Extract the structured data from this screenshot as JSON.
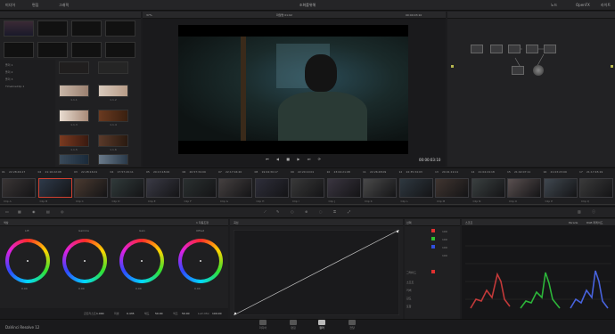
{
  "app": {
    "title": "조화를위해",
    "version": "DaVinci Resolve 12"
  },
  "topbar": {
    "left_items": [
      "미디어",
      "편집",
      "그래픽"
    ],
    "right_items": [
      "노드",
      "OpenFX",
      "라이트"
    ]
  },
  "viewer": {
    "title": "클립뷰어",
    "clip_name": "파일명 01:02",
    "timecode": "00:00:03:10",
    "zoom": "37%"
  },
  "media_pool": {
    "folders": [
      "폴더 1",
      "폴더 2",
      "폴더 3",
      "TimelineClip 1"
    ],
    "thumb_labels": [
      "1.1.1",
      "1.1.2",
      "1.1.3",
      "1.1.4",
      "1.1.5",
      "1.1.6",
      "1.1.7"
    ]
  },
  "timeline_clips": [
    {
      "num": "01",
      "tc": "22:28:46:17",
      "name": "Clip A"
    },
    {
      "num": "02",
      "tc": "21:16:22:08",
      "name": "Clip B"
    },
    {
      "num": "03",
      "tc": "22:28:16:01",
      "name": "Clip C"
    },
    {
      "num": "04",
      "tc": "17:57:20:11",
      "name": "Clip D"
    },
    {
      "num": "05",
      "tc": "20:13:18:00",
      "name": "Clip E"
    },
    {
      "num": "06",
      "tc": "20:57:34:09",
      "name": "Clip F"
    },
    {
      "num": "07",
      "tc": "22:17:04:20",
      "name": "Clip G"
    },
    {
      "num": "08",
      "tc": "19:04:30:17",
      "name": "Clip H"
    },
    {
      "num": "09",
      "tc": "22:20:10:01",
      "name": "Clip I"
    },
    {
      "num": "10",
      "tc": "23:04:21:08",
      "name": "Clip J"
    },
    {
      "num": "11",
      "tc": "22:26:48:09",
      "name": "Clip K"
    },
    {
      "num": "12",
      "tc": "22:35:34:03",
      "name": "Clip L"
    },
    {
      "num": "13",
      "tc": "20:01:19:11",
      "name": "Clip M"
    },
    {
      "num": "14",
      "tc": "21:04:24:18",
      "name": "Clip N"
    },
    {
      "num": "15",
      "tc": "21:02:07:11",
      "name": "Clip O"
    },
    {
      "num": "16",
      "tc": "21:03:23:09",
      "name": "Clip P"
    },
    {
      "num": "17",
      "tc": "21:17:45:19",
      "name": "Clip Q"
    }
  ],
  "color_panel": {
    "title": "색상",
    "mode": "1 자동조정",
    "wheels": [
      "Lift",
      "Gamma",
      "Gain",
      "Offset"
    ],
    "wheel_values": [
      "0.00",
      "0.00",
      "0.00",
      "0.00"
    ],
    "bottom_labels": [
      "콘트라스트",
      "피벗",
      "채도",
      "색조",
      "Lum Mix"
    ],
    "bottom_values": [
      "1.000",
      "0.435",
      "50.00",
      "50.00",
      "100.00"
    ]
  },
  "curves_panel": {
    "title": "곡선"
  },
  "right_panel": {
    "title": "선택",
    "sub": "그레이드",
    "values": [
      "100",
      "100",
      "100",
      "100"
    ],
    "labels": [
      "소프트",
      "커버",
      "감도",
      "포함"
    ]
  },
  "scopes": {
    "title": "스코프",
    "type": "Parade",
    "mode": "RGB 퍼레이드"
  },
  "pages": [
    "미디어",
    "편집",
    "컬러",
    "전달"
  ],
  "active_page": "컬러"
}
